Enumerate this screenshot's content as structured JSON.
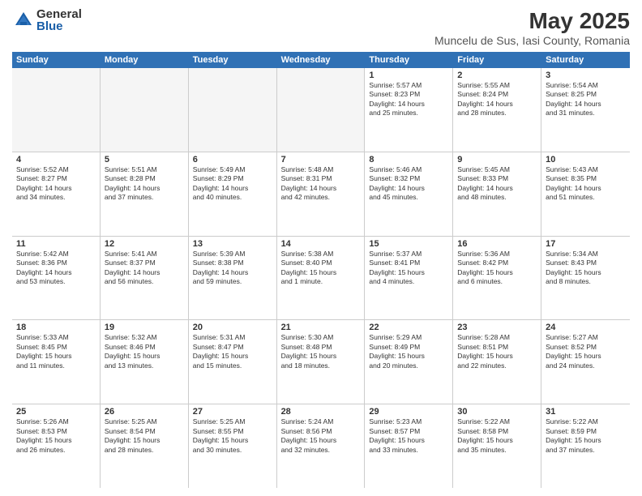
{
  "header": {
    "logo_general": "General",
    "logo_blue": "Blue",
    "title": "May 2025",
    "location": "Muncelu de Sus, Iasi County, Romania"
  },
  "days_of_week": [
    "Sunday",
    "Monday",
    "Tuesday",
    "Wednesday",
    "Thursday",
    "Friday",
    "Saturday"
  ],
  "weeks": [
    [
      {
        "day": "",
        "info": "",
        "empty": true
      },
      {
        "day": "",
        "info": "",
        "empty": true
      },
      {
        "day": "",
        "info": "",
        "empty": true
      },
      {
        "day": "",
        "info": "",
        "empty": true
      },
      {
        "day": "1",
        "info": "Sunrise: 5:57 AM\nSunset: 8:23 PM\nDaylight: 14 hours\nand 25 minutes."
      },
      {
        "day": "2",
        "info": "Sunrise: 5:55 AM\nSunset: 8:24 PM\nDaylight: 14 hours\nand 28 minutes."
      },
      {
        "day": "3",
        "info": "Sunrise: 5:54 AM\nSunset: 8:25 PM\nDaylight: 14 hours\nand 31 minutes."
      }
    ],
    [
      {
        "day": "4",
        "info": "Sunrise: 5:52 AM\nSunset: 8:27 PM\nDaylight: 14 hours\nand 34 minutes."
      },
      {
        "day": "5",
        "info": "Sunrise: 5:51 AM\nSunset: 8:28 PM\nDaylight: 14 hours\nand 37 minutes."
      },
      {
        "day": "6",
        "info": "Sunrise: 5:49 AM\nSunset: 8:29 PM\nDaylight: 14 hours\nand 40 minutes."
      },
      {
        "day": "7",
        "info": "Sunrise: 5:48 AM\nSunset: 8:31 PM\nDaylight: 14 hours\nand 42 minutes."
      },
      {
        "day": "8",
        "info": "Sunrise: 5:46 AM\nSunset: 8:32 PM\nDaylight: 14 hours\nand 45 minutes."
      },
      {
        "day": "9",
        "info": "Sunrise: 5:45 AM\nSunset: 8:33 PM\nDaylight: 14 hours\nand 48 minutes."
      },
      {
        "day": "10",
        "info": "Sunrise: 5:43 AM\nSunset: 8:35 PM\nDaylight: 14 hours\nand 51 minutes."
      }
    ],
    [
      {
        "day": "11",
        "info": "Sunrise: 5:42 AM\nSunset: 8:36 PM\nDaylight: 14 hours\nand 53 minutes."
      },
      {
        "day": "12",
        "info": "Sunrise: 5:41 AM\nSunset: 8:37 PM\nDaylight: 14 hours\nand 56 minutes."
      },
      {
        "day": "13",
        "info": "Sunrise: 5:39 AM\nSunset: 8:38 PM\nDaylight: 14 hours\nand 59 minutes."
      },
      {
        "day": "14",
        "info": "Sunrise: 5:38 AM\nSunset: 8:40 PM\nDaylight: 15 hours\nand 1 minute."
      },
      {
        "day": "15",
        "info": "Sunrise: 5:37 AM\nSunset: 8:41 PM\nDaylight: 15 hours\nand 4 minutes."
      },
      {
        "day": "16",
        "info": "Sunrise: 5:36 AM\nSunset: 8:42 PM\nDaylight: 15 hours\nand 6 minutes."
      },
      {
        "day": "17",
        "info": "Sunrise: 5:34 AM\nSunset: 8:43 PM\nDaylight: 15 hours\nand 8 minutes."
      }
    ],
    [
      {
        "day": "18",
        "info": "Sunrise: 5:33 AM\nSunset: 8:45 PM\nDaylight: 15 hours\nand 11 minutes."
      },
      {
        "day": "19",
        "info": "Sunrise: 5:32 AM\nSunset: 8:46 PM\nDaylight: 15 hours\nand 13 minutes."
      },
      {
        "day": "20",
        "info": "Sunrise: 5:31 AM\nSunset: 8:47 PM\nDaylight: 15 hours\nand 15 minutes."
      },
      {
        "day": "21",
        "info": "Sunrise: 5:30 AM\nSunset: 8:48 PM\nDaylight: 15 hours\nand 18 minutes."
      },
      {
        "day": "22",
        "info": "Sunrise: 5:29 AM\nSunset: 8:49 PM\nDaylight: 15 hours\nand 20 minutes."
      },
      {
        "day": "23",
        "info": "Sunrise: 5:28 AM\nSunset: 8:51 PM\nDaylight: 15 hours\nand 22 minutes."
      },
      {
        "day": "24",
        "info": "Sunrise: 5:27 AM\nSunset: 8:52 PM\nDaylight: 15 hours\nand 24 minutes."
      }
    ],
    [
      {
        "day": "25",
        "info": "Sunrise: 5:26 AM\nSunset: 8:53 PM\nDaylight: 15 hours\nand 26 minutes."
      },
      {
        "day": "26",
        "info": "Sunrise: 5:25 AM\nSunset: 8:54 PM\nDaylight: 15 hours\nand 28 minutes."
      },
      {
        "day": "27",
        "info": "Sunrise: 5:25 AM\nSunset: 8:55 PM\nDaylight: 15 hours\nand 30 minutes."
      },
      {
        "day": "28",
        "info": "Sunrise: 5:24 AM\nSunset: 8:56 PM\nDaylight: 15 hours\nand 32 minutes."
      },
      {
        "day": "29",
        "info": "Sunrise: 5:23 AM\nSunset: 8:57 PM\nDaylight: 15 hours\nand 33 minutes."
      },
      {
        "day": "30",
        "info": "Sunrise: 5:22 AM\nSunset: 8:58 PM\nDaylight: 15 hours\nand 35 minutes."
      },
      {
        "day": "31",
        "info": "Sunrise: 5:22 AM\nSunset: 8:59 PM\nDaylight: 15 hours\nand 37 minutes."
      }
    ]
  ]
}
